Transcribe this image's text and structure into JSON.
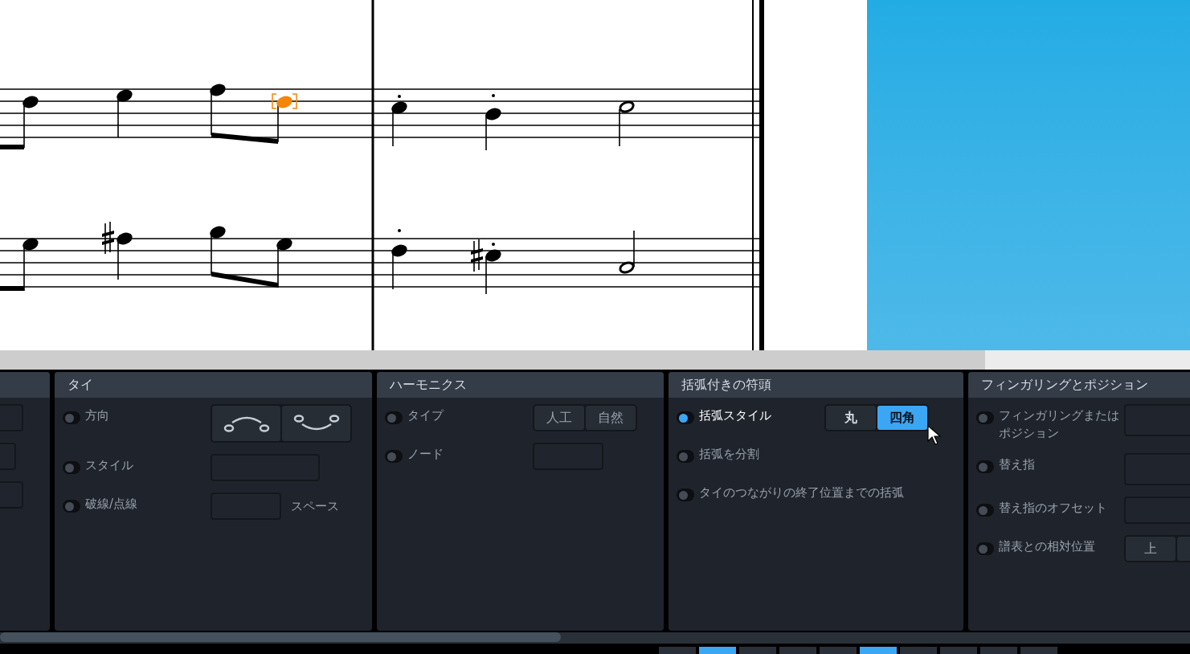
{
  "partial_panel": {
    "rows": [
      {
        "kind": "field"
      },
      {
        "kind": "field"
      },
      {
        "kind": "field"
      }
    ]
  },
  "panels": [
    {
      "title": "タイ",
      "rows": [
        {
          "label": "方向",
          "active": false,
          "control": {
            "kind": "segmented",
            "options": [
              {
                "kind": "icon",
                "selected": false
              },
              {
                "kind": "icon",
                "selected": false
              }
            ]
          }
        },
        {
          "label": "スタイル",
          "active": false,
          "control": {
            "kind": "field"
          }
        },
        {
          "label": "破線/点線",
          "active": false,
          "control": {
            "kind": "field",
            "suffix": "スペース"
          }
        }
      ]
    },
    {
      "title": "ハーモニクス",
      "rows": [
        {
          "label": "タイプ",
          "active": false,
          "control": {
            "kind": "segmented",
            "options": [
              {
                "label": "人工",
                "selected": false
              },
              {
                "label": "自然",
                "selected": false
              }
            ]
          }
        },
        {
          "label": "ノード",
          "active": false,
          "control": {
            "kind": "field"
          }
        }
      ]
    },
    {
      "title": "括弧付きの符頭",
      "rows": [
        {
          "label": "括弧スタイル",
          "active": true,
          "control": {
            "kind": "segmented",
            "options": [
              {
                "label": "丸",
                "selected": false
              },
              {
                "label": "四角",
                "selected": true
              }
            ]
          }
        },
        {
          "label": "括弧を分割",
          "active": false
        },
        {
          "label": "タイのつながりの終了位置までの括弧",
          "active": false
        }
      ]
    },
    {
      "title": "フィンガリングとポジション",
      "rows": [
        {
          "label": "フィンガリングまたはポジション",
          "active": false,
          "control": {
            "kind": "field"
          }
        },
        {
          "label": "替え指",
          "active": false,
          "control": {
            "kind": "field"
          }
        },
        {
          "label": "替え指のオフセット",
          "active": false,
          "control": {
            "kind": "field"
          }
        },
        {
          "label": "譜表との相対位置",
          "active": false,
          "control": {
            "kind": "segmented",
            "options": [
              {
                "label": "上",
                "selected": false
              },
              {
                "selected": false
              }
            ]
          }
        }
      ]
    }
  ],
  "bottom_toolbar": [
    {
      "selected": false
    },
    {
      "selected": true
    },
    {
      "selected": false
    },
    {
      "selected": false
    },
    {
      "selected": false
    },
    {
      "selected": true
    },
    {
      "selected": false
    },
    {
      "selected": false
    },
    {
      "selected": false
    },
    {
      "selected": false
    }
  ]
}
